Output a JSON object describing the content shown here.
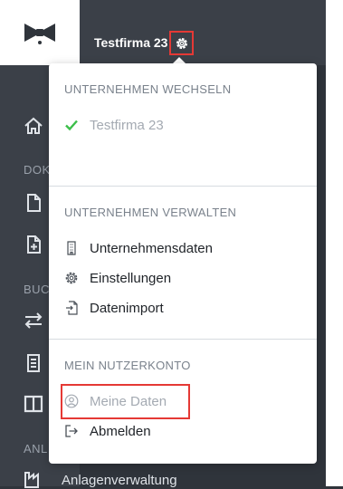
{
  "header": {
    "company_name": "Testfirma 23",
    "logo_icon": "bowtie-logo-icon",
    "settings_icon": "gear-icon"
  },
  "sidebar": {
    "section_labels": [
      "DOK",
      "BUC",
      "ANL"
    ],
    "partial_item": "Anlagenverwaltung",
    "icons": [
      "home-icon",
      "document-icon",
      "document-plus-icon",
      "transfer-icon",
      "invoice-icon",
      "columns-icon",
      "factory-icon"
    ]
  },
  "dropdown": {
    "switch_company": {
      "heading": "UNTERNEHMEN WECHSELN",
      "current": "Testfirma 23",
      "check_color": "#3cbf4a"
    },
    "manage_company": {
      "heading": "UNTERNEHMEN VERWALTEN",
      "items": [
        {
          "label": "Unternehmensdaten",
          "icon": "building-icon"
        },
        {
          "label": "Einstellungen",
          "icon": "gear-icon"
        },
        {
          "label": "Datenimport",
          "icon": "file-import-icon"
        }
      ]
    },
    "account": {
      "heading": "MEIN NUTZERKONTO",
      "items": [
        {
          "label": "Meine Daten",
          "icon": "user-circle-icon"
        },
        {
          "label": "Abmelden",
          "icon": "logout-icon"
        }
      ]
    }
  },
  "colors": {
    "highlight_border": "#e53935",
    "sidebar_bg": "#3b4048"
  }
}
